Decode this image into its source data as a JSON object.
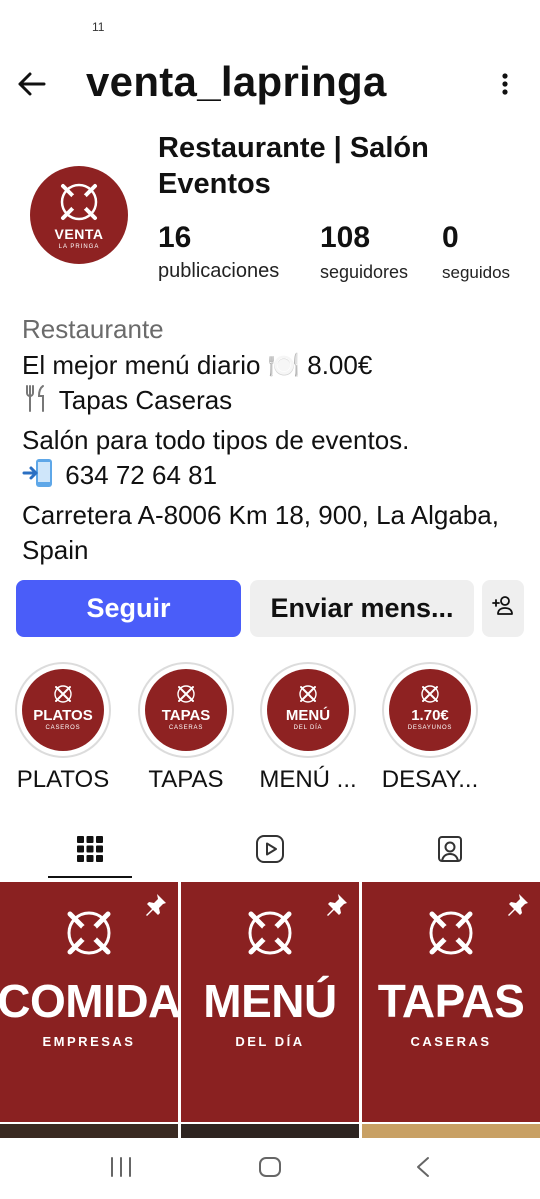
{
  "status": {
    "notification_count": "11"
  },
  "header": {
    "username": "venta_lapringa"
  },
  "profile": {
    "avatar_name": "VENTA",
    "avatar_subtitle": "LA PRINGA",
    "full_name": "Restaurante | Salón Eventos",
    "stats": {
      "posts": {
        "value": "16",
        "label": "publicaciones"
      },
      "followers": {
        "value": "108",
        "label": "seguidores"
      },
      "following": {
        "value": "0",
        "label": "seguidos"
      }
    }
  },
  "bio": {
    "category": "Restaurante",
    "line1": "El mejor menú diario 🍽️ 8.00€",
    "line2": "Tapas Caseras",
    "line3": "Salón para todo tipos de eventos.",
    "phone": "634 72 64 81",
    "address": "Carretera A-8006 Km 18, 900, La Algaba, Spain"
  },
  "actions": {
    "follow": "Seguir",
    "message": "Enviar mens..."
  },
  "highlights": [
    {
      "label": "PLATOS",
      "cover_title": "PLATOS",
      "cover_sub": "CASEROS"
    },
    {
      "label": "TAPAS",
      "cover_title": "TAPAS",
      "cover_sub": "CASERAS"
    },
    {
      "label": "MENÚ ...",
      "cover_title": "MENÚ",
      "cover_sub": "DEL DÍA"
    },
    {
      "label": "DESAY...",
      "cover_title": "1.70€",
      "cover_sub": "DESAYUNOS"
    }
  ],
  "tabs": [
    "grid-icon",
    "reels-icon",
    "tagged-icon"
  ],
  "posts": [
    {
      "title": "COMIDA",
      "subtitle": "EMPRESAS"
    },
    {
      "title": "MENÚ",
      "subtitle": "DEL DÍA"
    },
    {
      "title": "TAPAS",
      "subtitle": "CASERAS"
    }
  ],
  "colors": {
    "brand": "#8e2222",
    "follow_button": "#4a5df9",
    "secondary_button": "#efefef"
  }
}
